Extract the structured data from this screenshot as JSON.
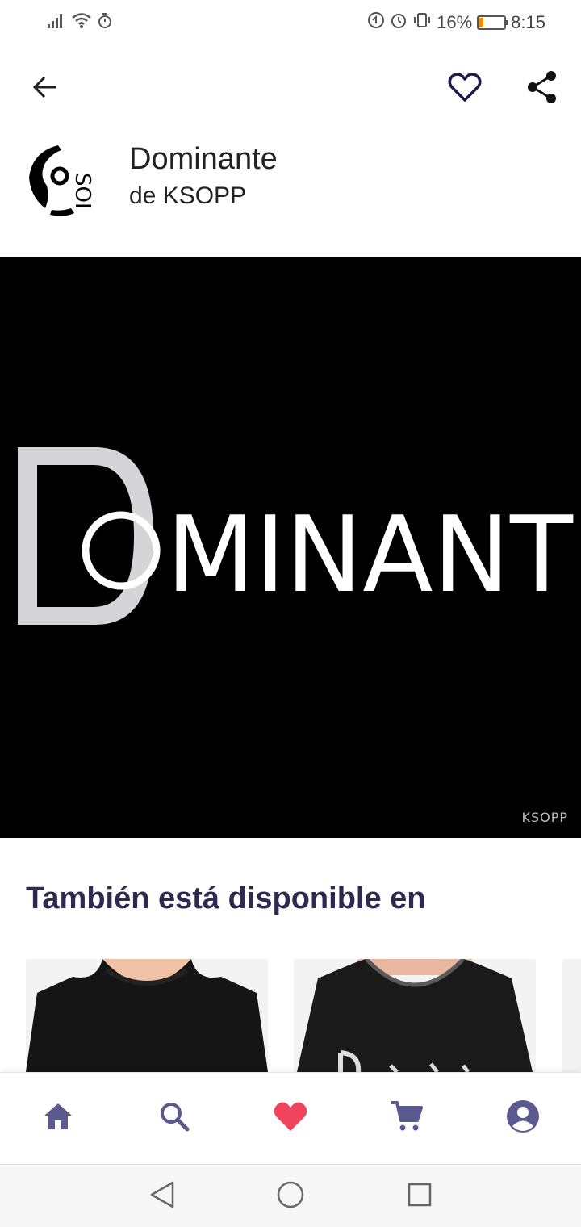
{
  "status_bar": {
    "battery_percent_label": "16%",
    "battery_level": 0.16,
    "time": "8:15",
    "icons": [
      "signal-icon",
      "wifi-icon",
      "timer-icon",
      "data-saver-icon",
      "alarm-icon",
      "vibrate-icon",
      "battery-icon"
    ]
  },
  "app_bar": {
    "back_icon": "arrow-left-icon",
    "favorite_icon": "heart-outline-icon",
    "share_icon": "share-icon"
  },
  "product": {
    "title": "Dominante",
    "artist": "de KSOPP",
    "artwork_text": "DOMINANT",
    "watermark": "KSOPP"
  },
  "also_available": {
    "title": "También está disponible en",
    "items": [
      "long-sleeve-tshirt-men",
      "long-sleeve-tshirt-women",
      "third-product"
    ]
  },
  "bottom_nav": {
    "items": [
      "home-icon",
      "search-icon",
      "heart-icon",
      "cart-icon",
      "account-icon"
    ],
    "active": "heart-icon"
  },
  "colors": {
    "accent_nav": "#5b5a8f",
    "favorite_active": "#f0445e",
    "heading": "#2e2a4f",
    "artwork_bg": "#000000",
    "artwork_D": "#d5d5d7"
  }
}
